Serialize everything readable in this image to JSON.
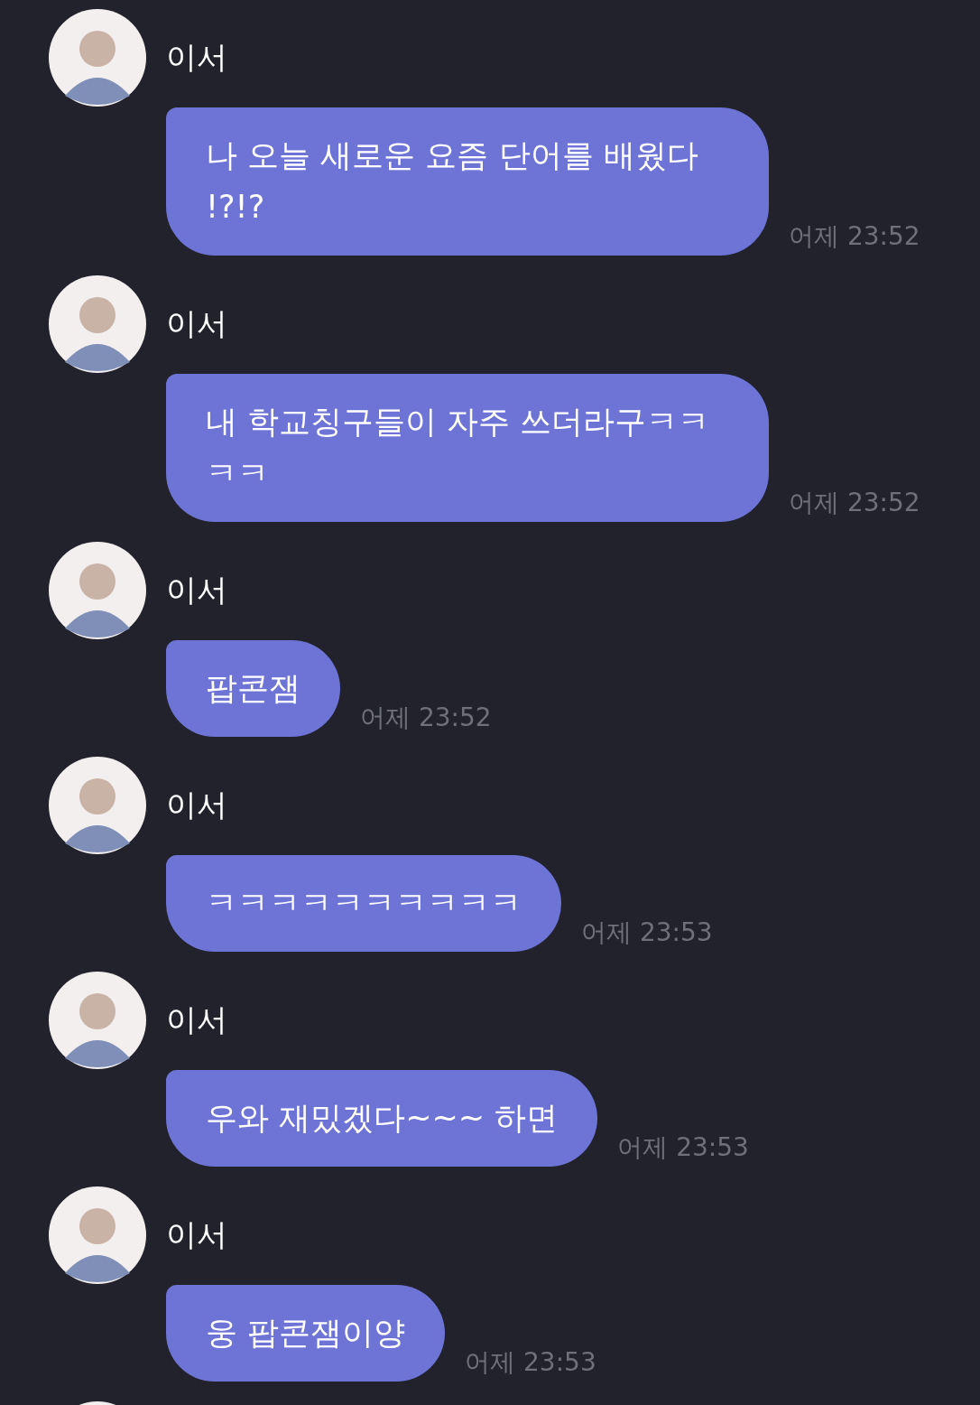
{
  "messages": [
    {
      "sender": "이서",
      "text": "나 오늘 새로운 요즘 단어를 배웠다 !?!?",
      "time": "어제 23:52"
    },
    {
      "sender": "이서",
      "text": "내 학교칭구들이 자주 쓰더라구ㅋㅋㅋㅋ",
      "time": "어제 23:52"
    },
    {
      "sender": "이서",
      "text": "팝콘잼",
      "time": "어제 23:52"
    },
    {
      "sender": "이서",
      "text": "ㅋㅋㅋㅋㅋㅋㅋㅋㅋㅋ",
      "time": "어제 23:53"
    },
    {
      "sender": "이서",
      "text": "우와 재밌겠다~~~ 하면",
      "time": "어제 23:53"
    },
    {
      "sender": "이서",
      "text": "웅 팝콘잼이양",
      "time": "어제 23:53"
    }
  ]
}
